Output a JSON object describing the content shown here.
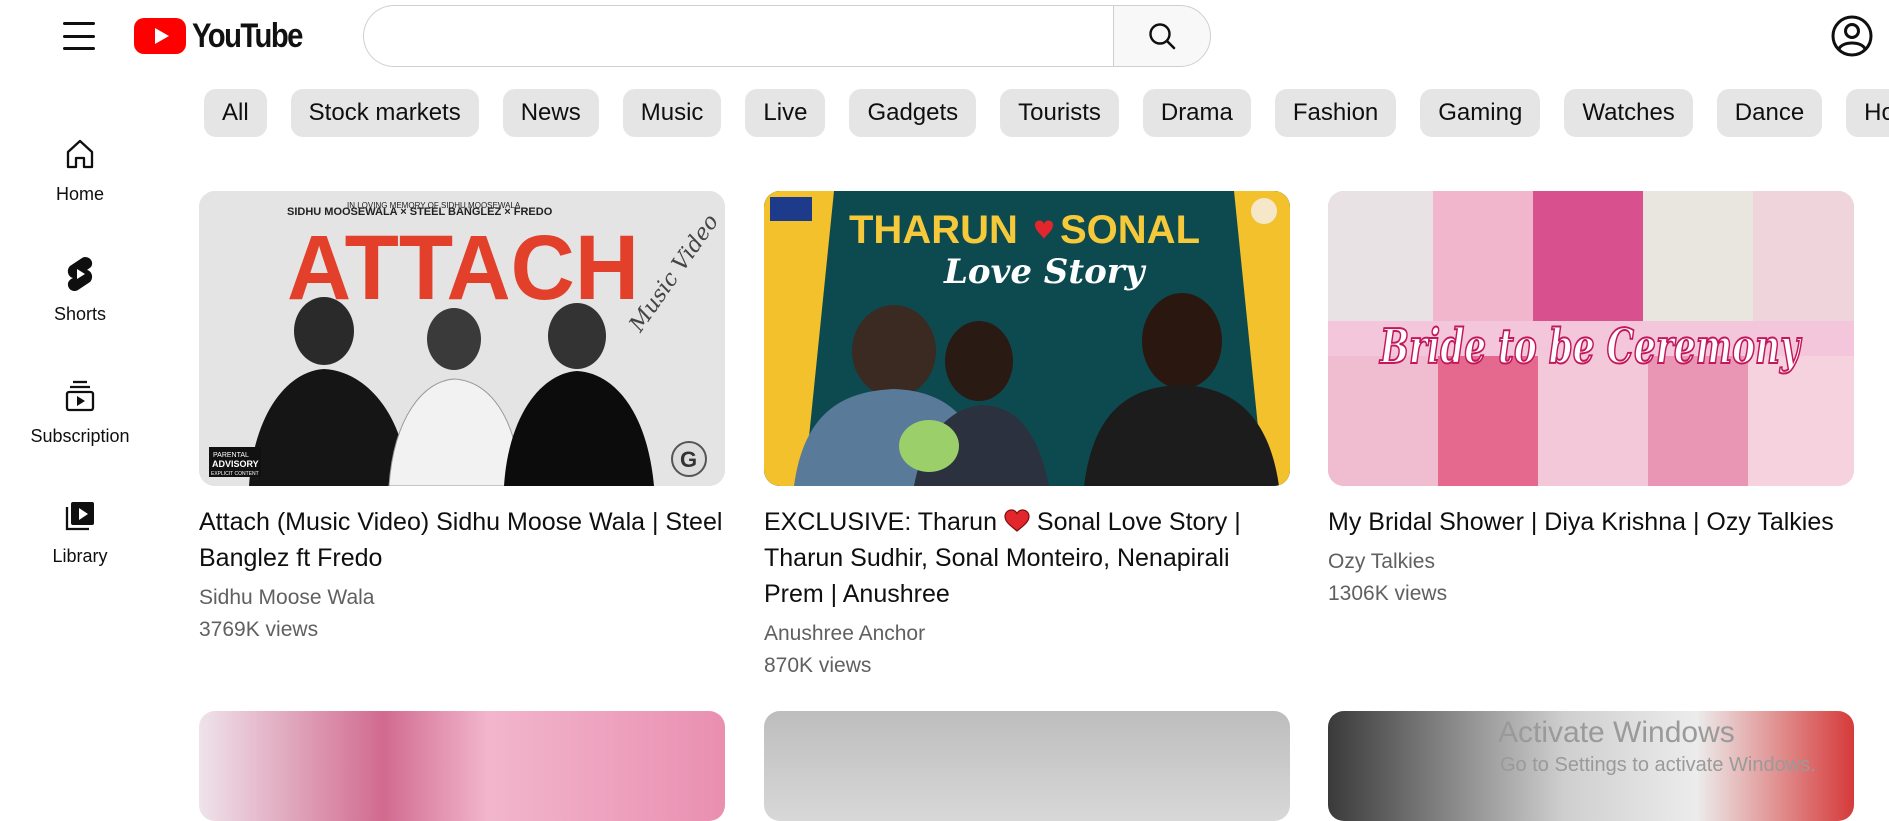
{
  "brand": {
    "name": "YouTube",
    "accent": "#ff0000"
  },
  "search": {
    "placeholder": "",
    "value": ""
  },
  "icons": {
    "menu": "menu-icon",
    "logo": "youtube-logo",
    "search": "search-icon",
    "account": "account-icon",
    "home": "home-icon",
    "shorts": "shorts-icon",
    "subscription": "subscription-icon",
    "library": "library-icon"
  },
  "chips": [
    "All",
    "Stock markets",
    "News",
    "Music",
    "Live",
    "Gadgets",
    "Tourists",
    "Drama",
    "Fashion",
    "Gaming",
    "Watches",
    "Dance",
    "Ho"
  ],
  "sidebar": {
    "items": [
      {
        "label": "Home"
      },
      {
        "label": "Shorts"
      },
      {
        "label": "Subscription"
      },
      {
        "label": "Library"
      }
    ]
  },
  "videos": [
    {
      "title": "Attach (Music Video) Sidhu Moose Wala | Steel Banglez ft Fredo",
      "channel": "Sidhu Moose Wala",
      "views": "3769K views",
      "thumb": {
        "memory": "IN LOVING MEMORY OF SIDHU MOOSEWALA",
        "artists": "SIDHU MOOSEWALA  ×  STEEL BANGLEZ  ×  FREDO",
        "big": "ATTACH",
        "script": "Music Video",
        "badge1": "PARENTAL",
        "badge2": "ADVISORY",
        "badge3": "EXPLICIT CONTENT",
        "corner": "G"
      }
    },
    {
      "title_pre": "EXCLUSIVE: Tharun",
      "title_post": "Sonal Love Story | Tharun Sudhir, Sonal Monteiro, Nenapirali Prem | Anushree",
      "channel": "Anushree Anchor",
      "views": "870K views",
      "thumb": {
        "line1a": "THARUN",
        "line1b": "SONAL",
        "line2": "Love Story"
      }
    },
    {
      "title": "My Bridal Shower | Diya Krishna | Ozy Talkies",
      "channel": "Ozy Talkies",
      "views": "1306K views",
      "thumb": {
        "overlay": "Bride to be Ceremony"
      }
    }
  ],
  "watermark": {
    "line1": "Activate Windows",
    "line2": "Go to Settings to activate Windows."
  }
}
